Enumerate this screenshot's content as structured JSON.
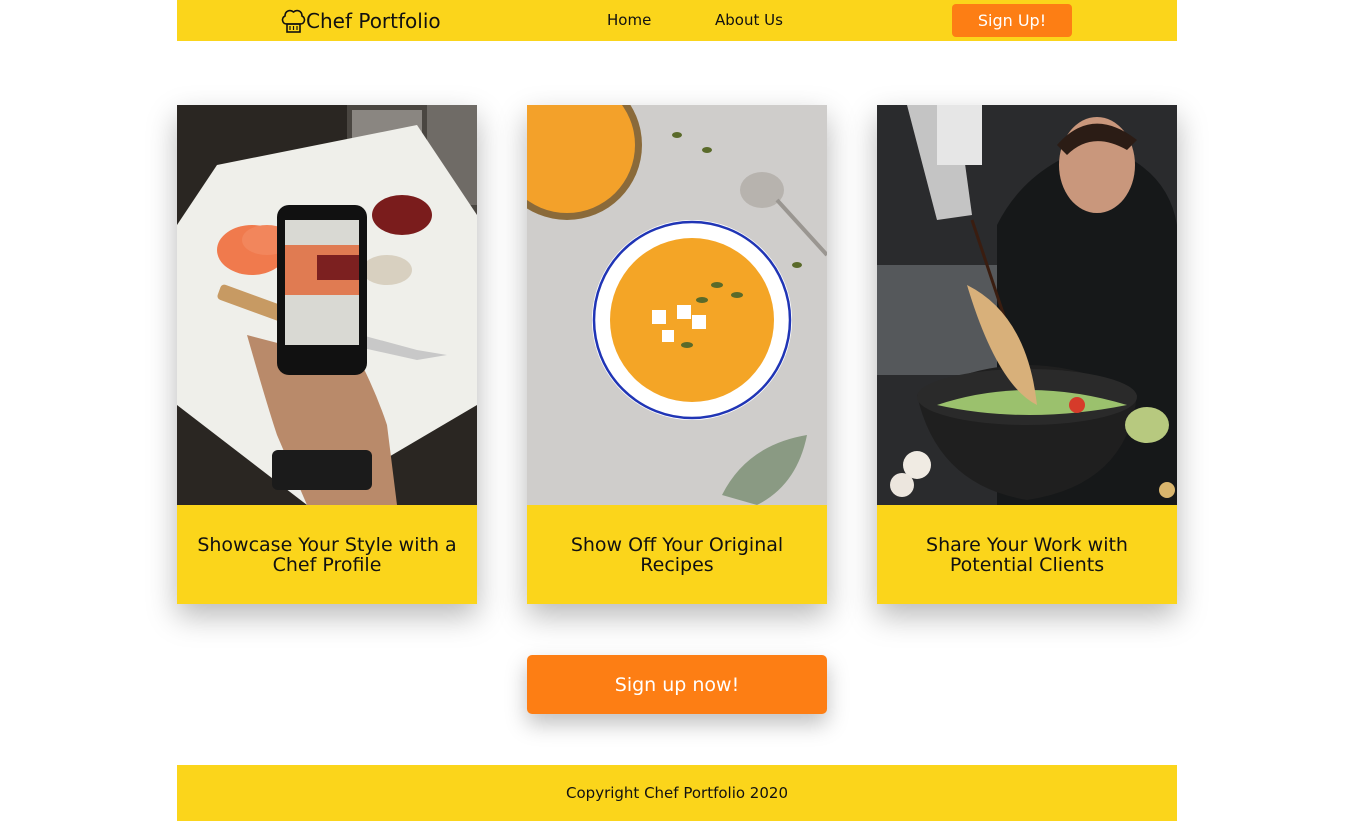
{
  "header": {
    "brand": "Chef Portfolio",
    "brand_icon": "chef-hat-icon",
    "nav": {
      "home": "Home",
      "about": "About Us"
    },
    "signup_label": "Sign Up!"
  },
  "cards": [
    {
      "title": "Showcase Your Style with a Chef Profile",
      "image": "phone-photographing-food"
    },
    {
      "title": "Show Off Your Original Recipes",
      "image": "soup-bowl"
    },
    {
      "title": "Share Your Work with Potential Clients",
      "image": "chef-plating-bowl"
    }
  ],
  "cta": {
    "label": "Sign up now!"
  },
  "footer": {
    "text": "Copyright Chef Portfolio 2020"
  },
  "colors": {
    "accent_yellow": "#fbd51b",
    "accent_orange": "#fd7e14"
  }
}
